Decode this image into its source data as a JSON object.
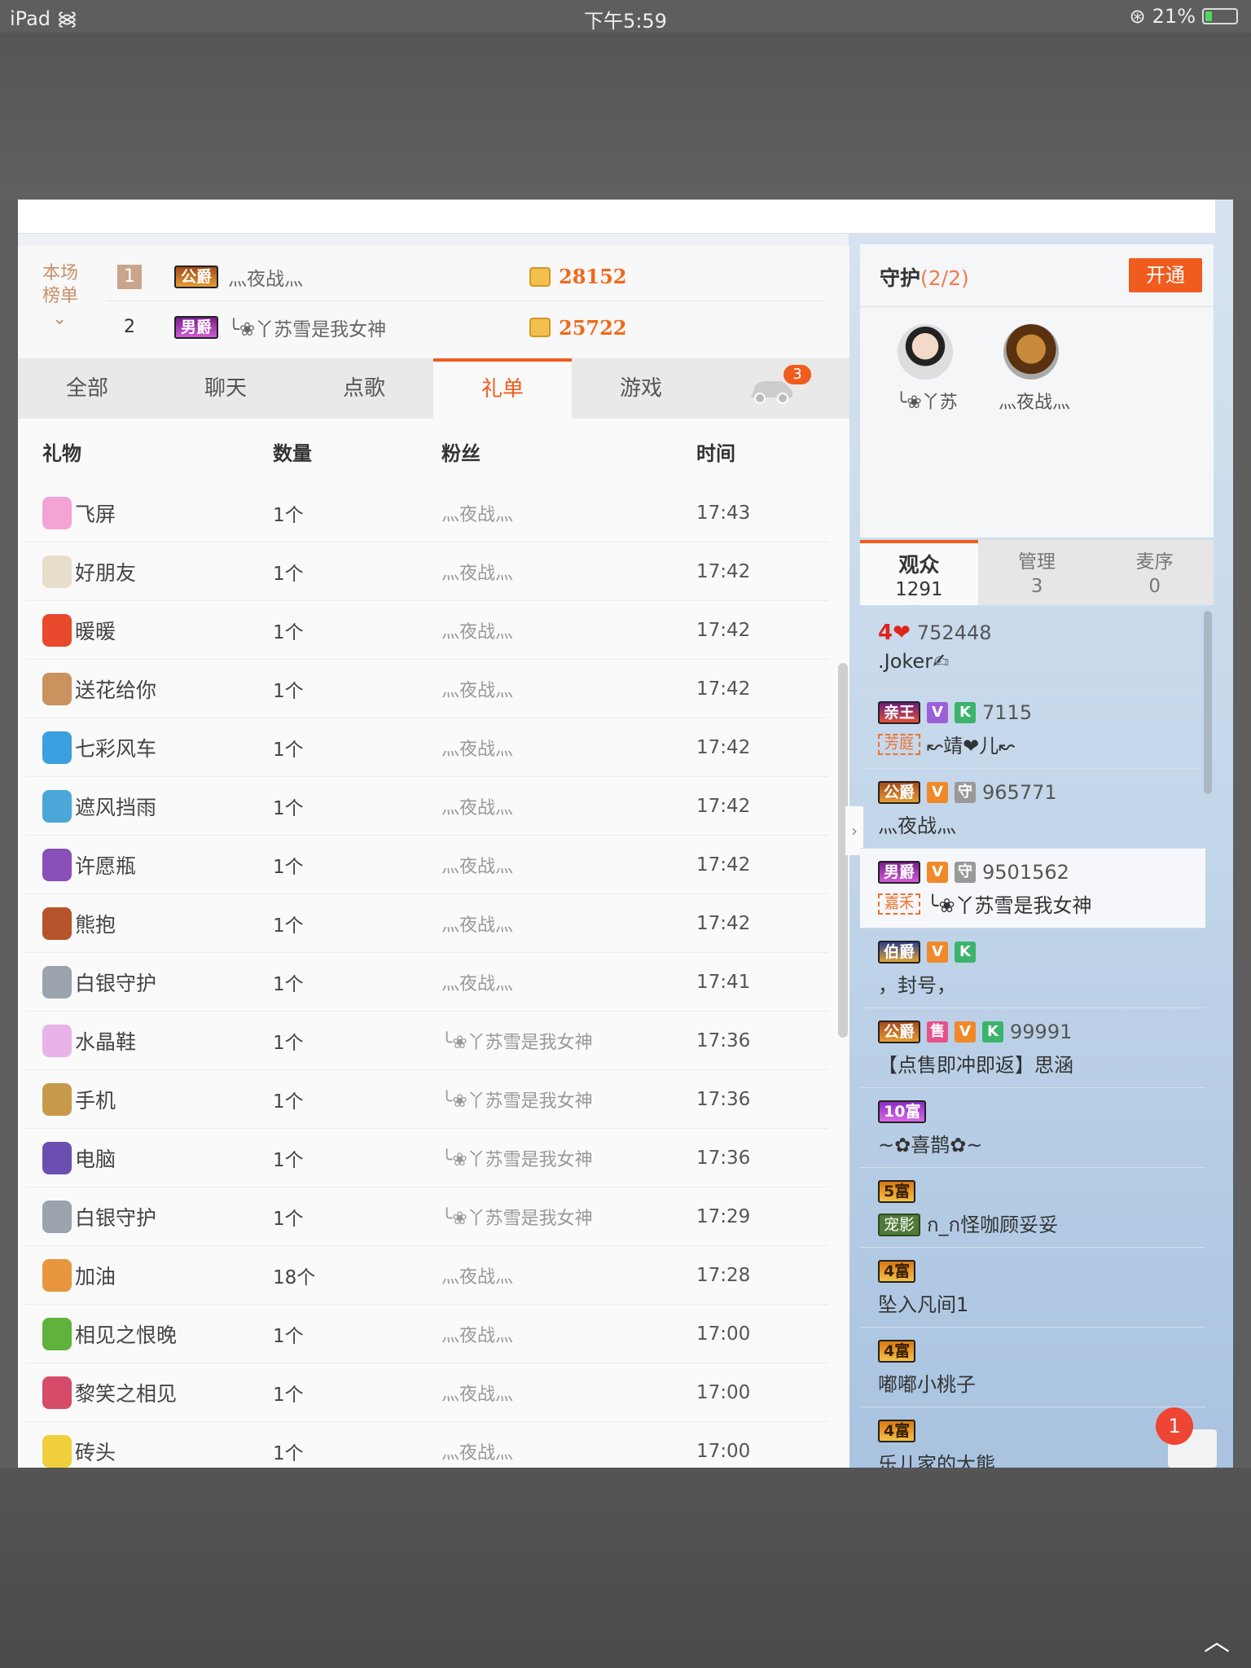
{
  "status_bar": {
    "device": "iPad",
    "time": "下午5:59",
    "battery": "21%",
    "battery_level": 0.21
  },
  "rank": {
    "label": "本场榜单",
    "rows": [
      {
        "pos": "1",
        "badge": "公爵",
        "name": "灬夜战灬",
        "coins": "28152"
      },
      {
        "pos": "2",
        "badge": "男爵",
        "name": "╰❀丫苏雪是我女神",
        "coins": "25722"
      }
    ]
  },
  "tabs": [
    {
      "label": "全部"
    },
    {
      "label": "聊天"
    },
    {
      "label": "点歌"
    },
    {
      "label": "礼单",
      "active": true
    },
    {
      "label": "游戏"
    }
  ],
  "car_badge": "3",
  "gift_table": {
    "headers": [
      "礼物",
      "数量",
      "粉丝",
      "时间"
    ],
    "rows": [
      {
        "gift": "飞屏",
        "qty": "1个",
        "fan": "灬夜战灬",
        "time": "17:43",
        "icon_color": "#f4a3d6"
      },
      {
        "gift": "好朋友",
        "qty": "1个",
        "fan": "灬夜战灬",
        "time": "17:42",
        "icon_color": "#e8dccb"
      },
      {
        "gift": "暖暖",
        "qty": "1个",
        "fan": "灬夜战灬",
        "time": "17:42",
        "icon_color": "#e8482b"
      },
      {
        "gift": "送花给你",
        "qty": "1个",
        "fan": "灬夜战灬",
        "time": "17:42",
        "icon_color": "#c9925e"
      },
      {
        "gift": "七彩风车",
        "qty": "1个",
        "fan": "灬夜战灬",
        "time": "17:42",
        "icon_color": "#3aa0e0"
      },
      {
        "gift": "遮风挡雨",
        "qty": "1个",
        "fan": "灬夜战灬",
        "time": "17:42",
        "icon_color": "#4aa7d8"
      },
      {
        "gift": "许愿瓶",
        "qty": "1个",
        "fan": "灬夜战灬",
        "time": "17:42",
        "icon_color": "#8a4fb8"
      },
      {
        "gift": "熊抱",
        "qty": "1个",
        "fan": "灬夜战灬",
        "time": "17:42",
        "icon_color": "#b5542a"
      },
      {
        "gift": "白银守护",
        "qty": "1个",
        "fan": "灬夜战灬",
        "time": "17:41",
        "icon_color": "#9ba3ad"
      },
      {
        "gift": "水晶鞋",
        "qty": "1个",
        "fan": "╰❀丫苏雪是我女神",
        "time": "17:36",
        "icon_color": "#e7b3e8"
      },
      {
        "gift": "手机",
        "qty": "1个",
        "fan": "╰❀丫苏雪是我女神",
        "time": "17:36",
        "icon_color": "#c79a4b"
      },
      {
        "gift": "电脑",
        "qty": "1个",
        "fan": "╰❀丫苏雪是我女神",
        "time": "17:36",
        "icon_color": "#6b4fb0"
      },
      {
        "gift": "白银守护",
        "qty": "1个",
        "fan": "╰❀丫苏雪是我女神",
        "time": "17:29",
        "icon_color": "#9ba3ad"
      },
      {
        "gift": "加油",
        "qty": "18个",
        "fan": "灬夜战灬",
        "time": "17:28",
        "icon_color": "#e7963e"
      },
      {
        "gift": "相见之恨晚",
        "qty": "1个",
        "fan": "灬夜战灬",
        "time": "17:00",
        "icon_color": "#5fb23c"
      },
      {
        "gift": "黎笑之相见",
        "qty": "1个",
        "fan": "灬夜战灬",
        "time": "17:00",
        "icon_color": "#d64b6a"
      },
      {
        "gift": "砖头",
        "qty": "1个",
        "fan": "灬夜战灬",
        "time": "17:00",
        "icon_color": "#f0cf3c"
      }
    ]
  },
  "guard": {
    "title": "守护",
    "count": "(2/2)",
    "open_label": "开通",
    "members": [
      {
        "name": "╰❀丫苏"
      },
      {
        "name": "灬夜战灬"
      }
    ]
  },
  "audience_tabs": [
    {
      "label": "观众",
      "count": "1291",
      "active": true
    },
    {
      "label": "管理",
      "count": "3"
    },
    {
      "label": "麦序",
      "count": "0"
    }
  ],
  "audience": [
    {
      "level": "4❤",
      "id": "752448",
      "name": ".Joker✍"
    },
    {
      "badge": "亲王",
      "vip": "V",
      "k": "K",
      "id": "7115",
      "family": "芳庭",
      "name": "↜靖❤儿↜"
    },
    {
      "badge": "公爵",
      "vip": "V",
      "guard": "守",
      "id": "965771",
      "name": "灬夜战灬"
    },
    {
      "badge": "男爵",
      "vip": "V",
      "guard": "守",
      "id": "9501562",
      "family": "嘉禾",
      "name": "╰❀丫苏雪是我女神"
    },
    {
      "badge": "伯爵",
      "vip": "V",
      "k": "K",
      "name": "，封号，"
    },
    {
      "badge": "公爵",
      "sell": "售",
      "vip": "V",
      "k": "K",
      "id": "99991",
      "name": "【点售即冲即返】思涵"
    },
    {
      "rich": "10富",
      "name": "~✿喜鹊✿~"
    },
    {
      "rich": "5富",
      "pet": "宠影",
      "name": "ก_ก怪咖顾妥妥"
    },
    {
      "rich": "4富",
      "name": "坠入凡间1"
    },
    {
      "rich": "4富",
      "name": "嘟嘟小桃子"
    },
    {
      "rich": "4富",
      "name": "乐儿家的大熊"
    }
  ],
  "mail_badge": "1"
}
